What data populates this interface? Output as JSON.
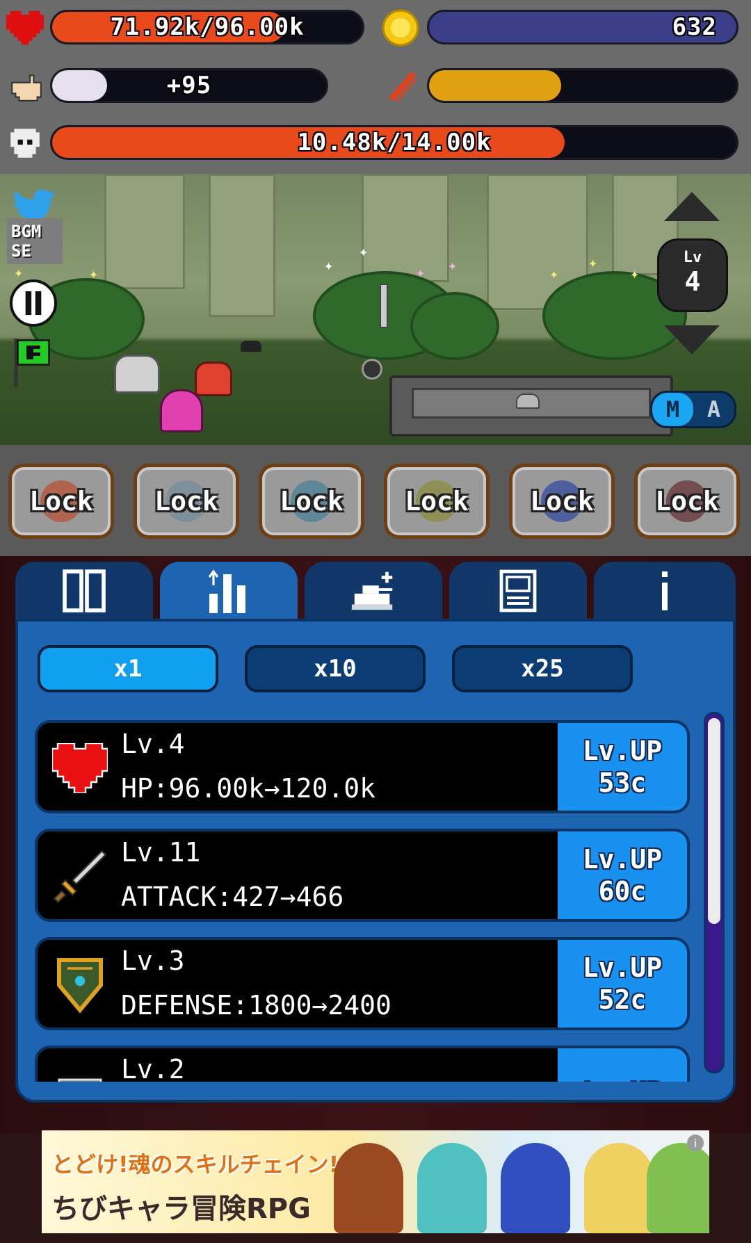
{
  "hud": {
    "hp": {
      "text": "71.92k/96.00k",
      "fill": 0.749,
      "color": "#e84a1c"
    },
    "coins": {
      "text": "632",
      "color": "#3b3f8a"
    },
    "tap": {
      "text": "+95",
      "fill": 0.2,
      "color": "#e6dfee"
    },
    "power": {
      "fill": 0.43,
      "color": "#e0a010"
    },
    "enemy_hp": {
      "text": "10.48k/14.00k",
      "fill": 0.749,
      "color": "#e84a1c"
    }
  },
  "scene": {
    "bgm_label": "BGM",
    "se_label": "SE",
    "level_label": "Lv",
    "level_value": "4",
    "mode_m": "M",
    "mode_a": "A"
  },
  "skills": [
    "Lock",
    "Lock",
    "Lock",
    "Lock",
    "Lock",
    "Lock"
  ],
  "tabs": [
    "equipment-tab",
    "upgrade-tab",
    "tank-tab",
    "document-tab",
    "info-tab"
  ],
  "multipliers": [
    "x1",
    "x10",
    "x25"
  ],
  "upgrades": [
    {
      "level": "Lv.4",
      "stat": "HP:96.00k→120.0k",
      "btn_line1": "Lv.UP",
      "btn_line2": "53c",
      "icon": "heart-icon"
    },
    {
      "level": "Lv.11",
      "stat": "ATTACK:427→466",
      "btn_line1": "Lv.UP",
      "btn_line2": "60c",
      "icon": "sword-icon"
    },
    {
      "level": "Lv.3",
      "stat": "DEFENSE:1800→2400",
      "btn_line1": "Lv.UP",
      "btn_line2": "52c",
      "icon": "shield-icon"
    },
    {
      "level": "Lv.2",
      "stat": "",
      "btn_line1": "Lv.UP",
      "btn_line2": "",
      "icon": "armor-icon"
    }
  ],
  "ad": {
    "line1": "とどけ!魂のスキルチェイン!",
    "line2": "ちびキャラ冒険RPG"
  }
}
